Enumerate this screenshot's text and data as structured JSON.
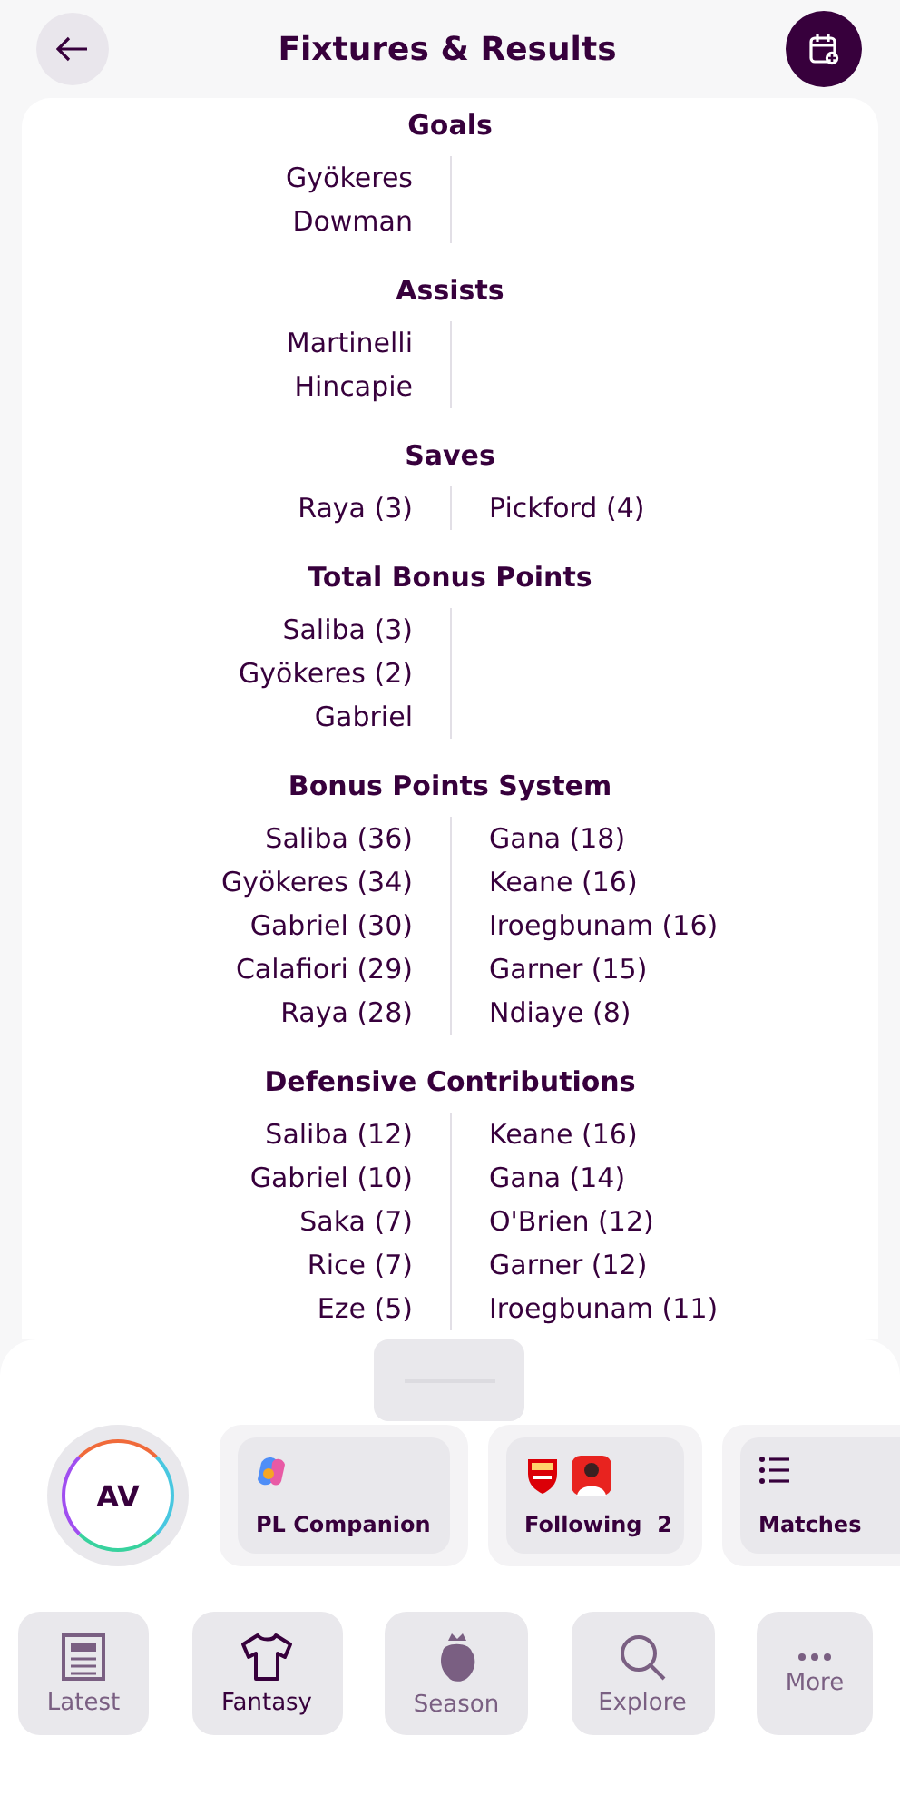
{
  "header": {
    "title": "Fixtures & Results"
  },
  "stats": [
    {
      "title": "Goals",
      "home": [
        "Gyökeres",
        "Dowman"
      ]
    },
    {
      "title": "Assists",
      "home": [
        "Martinelli",
        "Hincapie"
      ]
    },
    {
      "title": "Saves",
      "home": [
        "Raya (3)"
      ],
      "away": [
        "Pickford (4)"
      ]
    },
    {
      "title": "Total Bonus Points",
      "home": [
        "Saliba (3)",
        "Gyökeres (2)",
        "Gabriel"
      ]
    },
    {
      "title": "Bonus Points System",
      "home": [
        "Saliba (36)",
        "Gyökeres (34)",
        "Gabriel (30)",
        "Calafiori (29)",
        "Raya (28)"
      ],
      "away": [
        "Gana (18)",
        "Keane (16)",
        "Iroegbunam (16)",
        "Garner (15)",
        "Ndiaye (8)"
      ]
    },
    {
      "title": "Defensive Contributions",
      "home": [
        "Saliba (12)",
        "Gabriel (10)",
        "Saka (7)",
        "Rice (7)",
        "Eze (5)"
      ],
      "away": [
        "Keane (16)",
        "Gana (14)",
        "O'Brien (12)",
        "Garner (12)",
        "Iroegbunam (11)"
      ]
    }
  ],
  "quick_access": {
    "avatar": "AV",
    "tiles": [
      {
        "kind": "companion",
        "label": "PL Companion"
      },
      {
        "kind": "following",
        "label": "Following",
        "count": "2"
      },
      {
        "kind": "matches",
        "label": "Matches"
      }
    ]
  },
  "nav": [
    {
      "kind": "latest",
      "label": "Latest",
      "selected": false
    },
    {
      "kind": "fantasy",
      "label": "Fantasy",
      "selected": true
    },
    {
      "kind": "season",
      "label": "Season",
      "selected": false
    },
    {
      "kind": "explore",
      "label": "Explore",
      "selected": false
    },
    {
      "kind": "more",
      "label": "More",
      "selected": false
    }
  ]
}
